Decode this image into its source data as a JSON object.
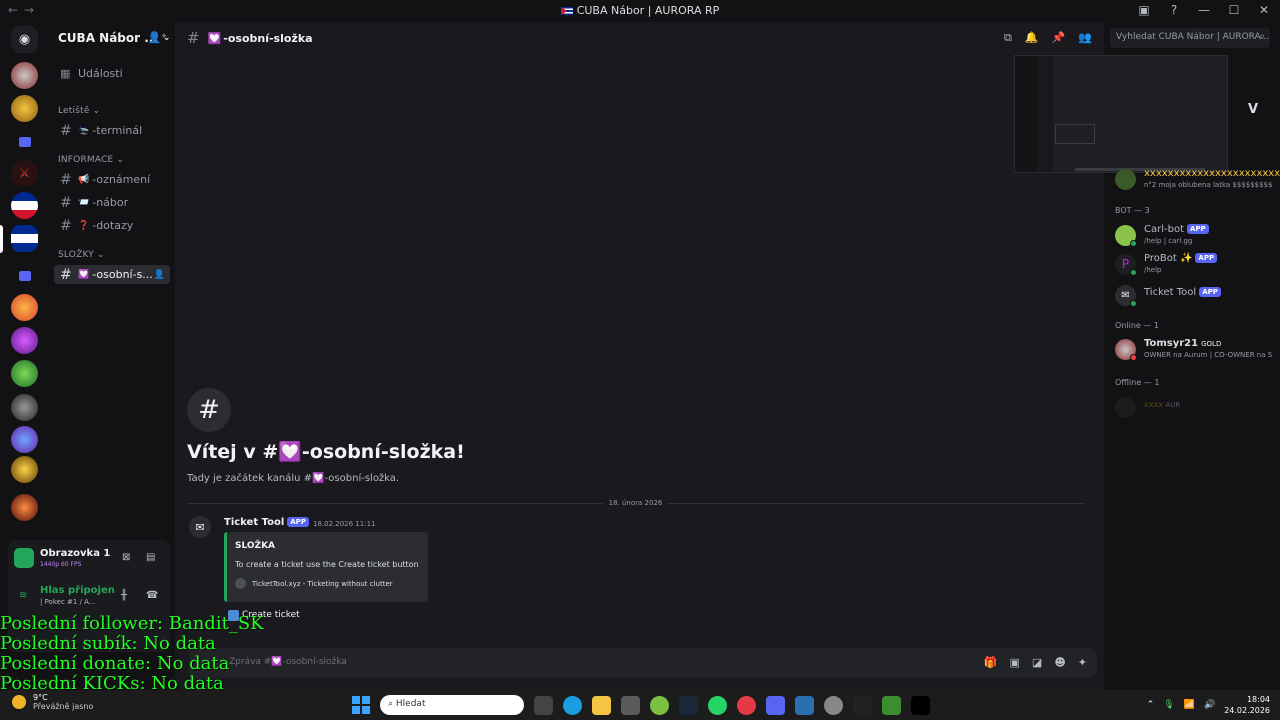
{
  "window": {
    "title": "CUBA Nábor | AURORA RP"
  },
  "server": {
    "name": "CUBA Nábor ...",
    "events_label": "Události"
  },
  "sidebar": {
    "categories": [
      "Letiště",
      "INFORMACE",
      "SLOŽKY"
    ],
    "channels": [
      {
        "name": "-terminál",
        "emoji": "🛬"
      },
      {
        "name": "-oznámení",
        "emoji": "📢"
      },
      {
        "name": "-nábor",
        "emoji": "📨"
      },
      {
        "name": "-dotazy",
        "emoji": "❓"
      },
      {
        "name": "-osobní-s...",
        "emoji": "💟"
      }
    ]
  },
  "channel": {
    "name": "-osobní-složka",
    "emoji": "💟",
    "search_placeholder": "Vyhledat CUBA Nábor | AURORA...",
    "welcome_title": "Vítej v #💟-osobní-složka!",
    "welcome_sub": "Tady je začátek kanálu #💟-osobní-složka.",
    "date": "18. února 2026",
    "composer_placeholder": "Zpráva #💟-osobní-složka"
  },
  "message": {
    "author": "Ticket Tool",
    "badge": "APP",
    "time": "18.02.2026 11:11",
    "embed_title": "SLOŽKA",
    "embed_desc": "To create a ticket use the Create ticket button",
    "embed_footer": "TicketTool.xyz - Ticketing without clutter",
    "button_label": "Create ticket",
    "accent_color": "#23a55a"
  },
  "userpanel": {
    "screen_title": "Obrazovka 1",
    "screen_sub": "1440p 60 FPS",
    "voice_status": "Hlas připojen",
    "voice_channel": "| Pokec #1 / A..."
  },
  "members": {
    "partial_top_name": "xxxxxxxxxxxxxxxxxxxxxxxxx...",
    "partial_top_status": "n°2 moja oblubena latka $$$$$$$$$",
    "bot_header": "BOT — 3",
    "bots": [
      {
        "name": "Carl-bot",
        "badge": "APP",
        "status": "/help | carl.gg"
      },
      {
        "name": "ProBot ✨",
        "badge": "APP",
        "status": "/help"
      },
      {
        "name": "Ticket Tool",
        "badge": "APP",
        "status": ""
      }
    ],
    "online_header": "Online — 1",
    "online": [
      {
        "name": "Tomsyr21",
        "badge": "GOLD",
        "status": "OWNER na Aurum | CO-OWNER na S"
      }
    ],
    "offline_header": "Offline — 1",
    "offline": [
      {
        "name": "xxxx",
        "badge": "AUR"
      }
    ]
  },
  "overlay": {
    "line1": "Poslední follower: Bandit_SK",
    "line2": "Poslední subík: No data",
    "line3": "Poslední donate: No data",
    "line4": "Poslední KICKs: No data"
  },
  "taskbar": {
    "temp": "9°C",
    "weather": "Převážně jasno",
    "search": "Hledat",
    "time": "18:04",
    "date": "24.02.2026"
  },
  "colors": {
    "accent": "#5865f2",
    "online": "#23a55a",
    "overlay_text": "#22ff22"
  }
}
